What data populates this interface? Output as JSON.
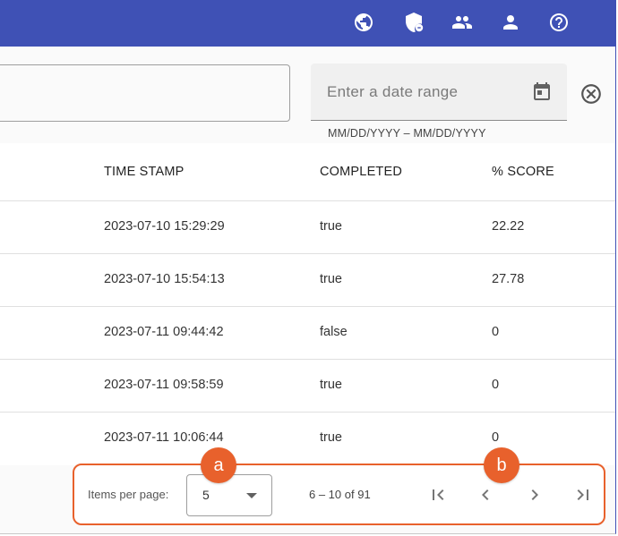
{
  "appbar": {
    "icons": [
      "globe-icon",
      "shield-account-icon",
      "group-icon",
      "person-icon",
      "help-icon"
    ]
  },
  "filters": {
    "date_placeholder": "Enter a date range",
    "date_hint": "MM/DD/YYYY – MM/DD/YYYY"
  },
  "table": {
    "headers": [
      "TIME STAMP",
      "COMPLETED",
      "% SCORE"
    ],
    "rows": [
      [
        "2023-07-10 15:29:29",
        "true",
        "22.22"
      ],
      [
        "2023-07-10 15:54:13",
        "true",
        "27.78"
      ],
      [
        "2023-07-11 09:44:42",
        "false",
        "0"
      ],
      [
        "2023-07-11 09:58:59",
        "true",
        "0"
      ],
      [
        "2023-07-11 10:06:44",
        "true",
        "0"
      ]
    ]
  },
  "paginator": {
    "items_per_page_label": "Items per page:",
    "items_per_page_value": "5",
    "range_label": "6 – 10 of 91"
  },
  "callouts": {
    "a": "a",
    "b": "b"
  },
  "colors": {
    "appbar": "#3f51b5",
    "callout": "#e8612c"
  }
}
